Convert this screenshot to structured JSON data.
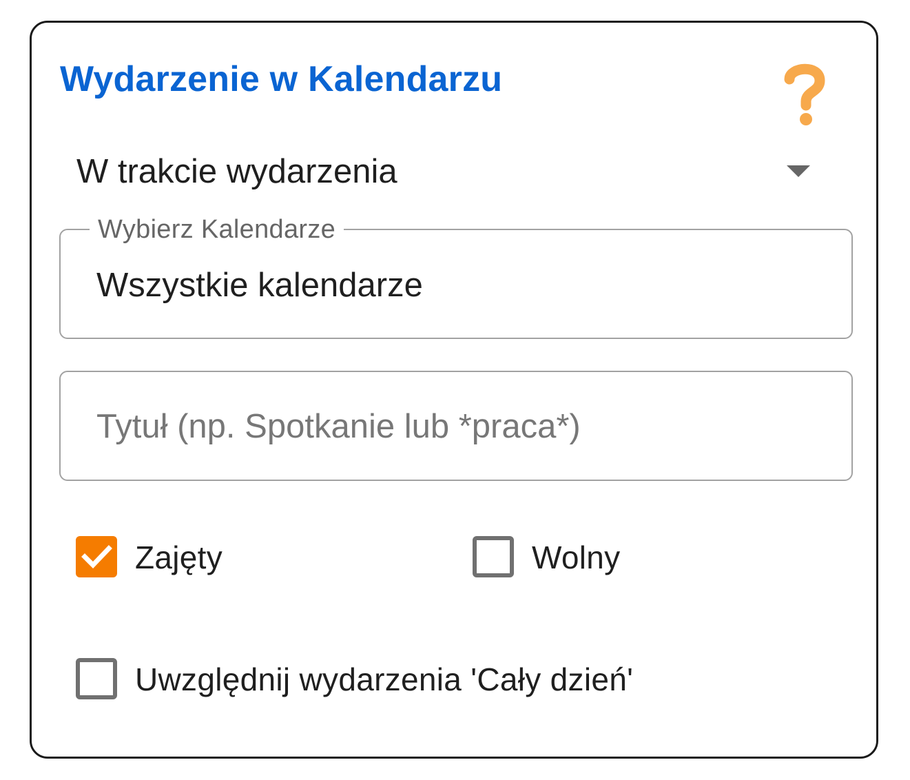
{
  "panel": {
    "title": "Wydarzenie w Kalendarzu",
    "help_icon": "question-mark-icon",
    "colors": {
      "title": "#0a64d2",
      "accent": "#f57c00",
      "help_icon": "#f7a94c"
    }
  },
  "event_state": {
    "selected": "W trakcie wydarzenia"
  },
  "calendars": {
    "label": "Wybierz Kalendarze",
    "value": "Wszystkie kalendarze"
  },
  "title_filter": {
    "placeholder": "Tytuł (np. Spotkanie lub *praca*)",
    "value": ""
  },
  "checkboxes": {
    "busy": {
      "label": "Zajęty",
      "checked": true
    },
    "free": {
      "label": "Wolny",
      "checked": false
    },
    "all_day": {
      "label": "Uwzględnij wydarzenia 'Cały dzień'",
      "checked": false
    }
  }
}
